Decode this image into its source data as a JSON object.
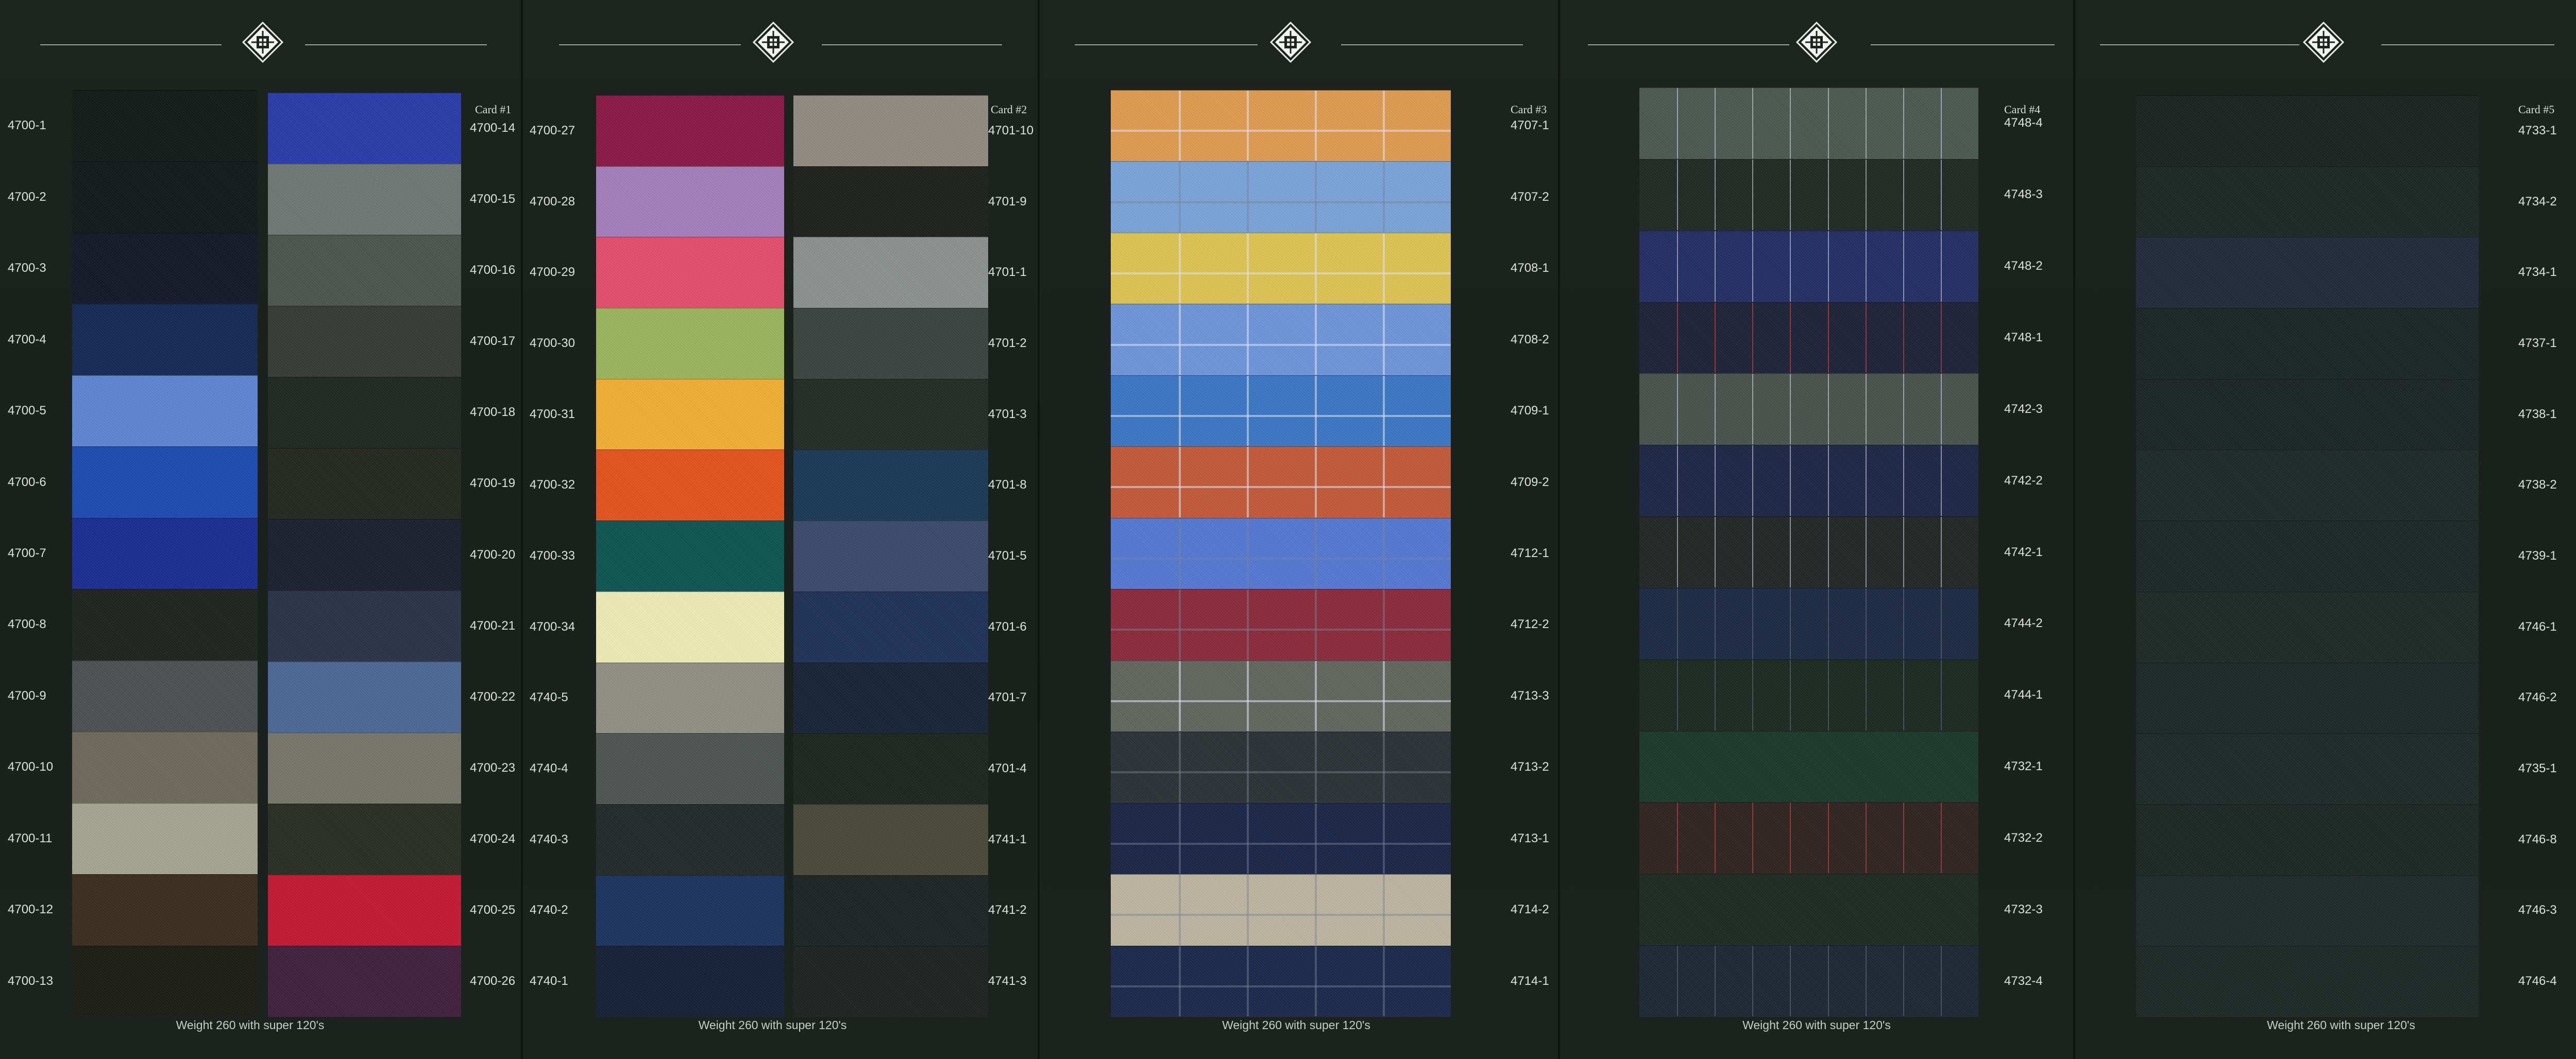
{
  "footer_text": "Weight 260 with super 120's",
  "cards": [
    {
      "title": "Card #1",
      "columns": [
        {
          "swatches": [
            {
              "code": "4700-1",
              "color": "#151b18"
            },
            {
              "code": "4700-2",
              "color": "#141a1b"
            },
            {
              "code": "4700-3",
              "color": "#141a28"
            },
            {
              "code": "4700-4",
              "color": "#162a57"
            },
            {
              "code": "4700-5",
              "color": "#5d85d2"
            },
            {
              "code": "4700-6",
              "color": "#1d4bb0"
            },
            {
              "code": "4700-7",
              "color": "#1c2e8f"
            },
            {
              "code": "4700-8",
              "color": "#1f2421"
            },
            {
              "code": "4700-9",
              "color": "#4d5153"
            },
            {
              "code": "4700-10",
              "color": "#6d6a5b"
            },
            {
              "code": "4700-11",
              "color": "#a5a391"
            },
            {
              "code": "4700-12",
              "color": "#3a2e1f"
            },
            {
              "code": "4700-13",
              "color": "#1d1d18"
            }
          ]
        },
        {
          "swatches": [
            {
              "code": "4700-14",
              "color": "#2a3da8"
            },
            {
              "code": "4700-15",
              "color": "#6f7775"
            },
            {
              "code": "4700-16",
              "color": "#4d5551"
            },
            {
              "code": "4700-17",
              "color": "#363b37"
            },
            {
              "code": "4700-18",
              "color": "#1f2822"
            },
            {
              "code": "4700-19",
              "color": "#25281f"
            },
            {
              "code": "4700-20",
              "color": "#1c2030"
            },
            {
              "code": "4700-21",
              "color": "#2a3349"
            },
            {
              "code": "4700-22",
              "color": "#4b6894"
            },
            {
              "code": "4700-23",
              "color": "#77766b"
            },
            {
              "code": "4700-24",
              "color": "#2a2e25"
            },
            {
              "code": "4700-25",
              "color": "#c21a34"
            },
            {
              "code": "4700-26",
              "color": "#42203e"
            }
          ]
        }
      ]
    },
    {
      "title": "Card #2",
      "columns": [
        {
          "swatches": [
            {
              "code": "4700-27",
              "color": "#8a1a45"
            },
            {
              "code": "4700-28",
              "color": "#a27fb8"
            },
            {
              "code": "4700-29",
              "color": "#e24e6e"
            },
            {
              "code": "4700-30",
              "color": "#9ab45c"
            },
            {
              "code": "4700-31",
              "color": "#f0ad35"
            },
            {
              "code": "4700-32",
              "color": "#e2531f"
            },
            {
              "code": "4700-33",
              "color": "#0f5553"
            },
            {
              "code": "4700-34",
              "color": "#ebeab5"
            },
            {
              "code": "4740-5",
              "color": "#8f8f86"
            },
            {
              "code": "4740-4",
              "color": "#4f5552"
            },
            {
              "code": "4740-3",
              "color": "#222b2a"
            },
            {
              "code": "4740-2",
              "color": "#1c3560"
            },
            {
              "code": "4740-1",
              "color": "#16203a"
            }
          ]
        },
        {
          "swatches": [
            {
              "code": "4701-10",
              "color": "#908a80"
            },
            {
              "code": "4701-9",
              "color": "#1f211c"
            },
            {
              "code": "4701-1",
              "color": "#8b918e"
            },
            {
              "code": "4701-2",
              "color": "#3b4440"
            },
            {
              "code": "4701-3",
              "color": "#232c27"
            },
            {
              "code": "4701-8",
              "color": "#1c3a55"
            },
            {
              "code": "4701-5",
              "color": "#3b4a6a"
            },
            {
              "code": "4701-6",
              "color": "#1f3358"
            },
            {
              "code": "4701-7",
              "color": "#1a2438"
            },
            {
              "code": "4701-4",
              "color": "#1e2621"
            },
            {
              "code": "4741-1",
              "color": "#4a4a3a"
            },
            {
              "code": "4741-2",
              "color": "#1f2525"
            },
            {
              "code": "4741-3",
              "color": "#1f2322"
            }
          ]
        }
      ]
    },
    {
      "title": "Card #3",
      "columns": [
        {
          "swatches": [
            {
              "code": "4707-1",
              "color": "#dd9a52",
              "pattern": "check-light"
            },
            {
              "code": "4707-2",
              "color": "#7aa3d8",
              "pattern": "check-dark"
            },
            {
              "code": "4708-1",
              "color": "#dcc253",
              "pattern": "check-light"
            },
            {
              "code": "4708-2",
              "color": "#6d95d9",
              "pattern": "check-light"
            },
            {
              "code": "4709-1",
              "color": "#3c77c2",
              "pattern": "check-light"
            },
            {
              "code": "4709-2",
              "color": "#c05a3b",
              "pattern": "check-light"
            },
            {
              "code": "4712-1",
              "color": "#5578cf",
              "pattern": "check-dark"
            },
            {
              "code": "4712-2",
              "color": "#8a2a3d",
              "pattern": "check-dark"
            },
            {
              "code": "4713-3",
              "color": "#61665f",
              "pattern": "check-light"
            },
            {
              "code": "4713-2",
              "color": "#2c3336",
              "pattern": "check-dark"
            },
            {
              "code": "4713-1",
              "color": "#1b2747",
              "pattern": "check-dark"
            },
            {
              "code": "4714-2",
              "color": "#bcb49f",
              "pattern": "check-dark"
            },
            {
              "code": "4714-1",
              "color": "#1b2a4c",
              "pattern": "check-dark"
            }
          ]
        }
      ]
    },
    {
      "title": "Card #4",
      "columns": [
        {
          "swatches": [
            {
              "code": "4748-4",
              "color": "#4d5852",
              "pattern": "stripe-light"
            },
            {
              "code": "4748-3",
              "color": "#222a25",
              "pattern": "stripe-light"
            },
            {
              "code": "4748-2",
              "color": "#233064",
              "pattern": "stripe-light"
            },
            {
              "code": "4748-1",
              "color": "#1f2338",
              "pattern": "stripe-red"
            },
            {
              "code": "4742-3",
              "color": "#4a524d",
              "pattern": "stripe-light"
            },
            {
              "code": "4742-2",
              "color": "#1f2747",
              "pattern": "stripe-light"
            },
            {
              "code": "4742-1",
              "color": "#232826",
              "pattern": "stripe-light"
            },
            {
              "code": "4744-2",
              "color": "#1d2a44",
              "pattern": "stripe-dark"
            },
            {
              "code": "4744-1",
              "color": "#1e2922",
              "pattern": "stripe-dark"
            },
            {
              "code": "4732-1",
              "color": "#1b3a2c"
            },
            {
              "code": "4732-2",
              "color": "#2f2522",
              "pattern": "stripe-red"
            },
            {
              "code": "4732-3",
              "color": "#1f2a25"
            },
            {
              "code": "4732-4",
              "color": "#1d2834",
              "pattern": "stripe-dark"
            }
          ]
        }
      ]
    },
    {
      "title": "Card #5",
      "columns": [
        {
          "swatches": [
            {
              "code": "4733-1",
              "color": "#1b2421"
            },
            {
              "code": "4734-2",
              "color": "#1d2825"
            },
            {
              "code": "4734-1",
              "color": "#222a3c"
            },
            {
              "code": "4737-1",
              "color": "#1c2725"
            },
            {
              "code": "4738-1",
              "color": "#1c2624"
            },
            {
              "code": "4738-2",
              "color": "#1e2a27"
            },
            {
              "code": "4739-1",
              "color": "#1d2826"
            },
            {
              "code": "4746-1",
              "color": "#1f2a27"
            },
            {
              "code": "4746-2",
              "color": "#1d2926"
            },
            {
              "code": "4735-1",
              "color": "#1e2a27"
            },
            {
              "code": "4746-8",
              "color": "#1d2825"
            },
            {
              "code": "4746-3",
              "color": "#1f2b28"
            },
            {
              "code": "4746-4",
              "color": "#1e2926"
            }
          ]
        }
      ]
    }
  ]
}
